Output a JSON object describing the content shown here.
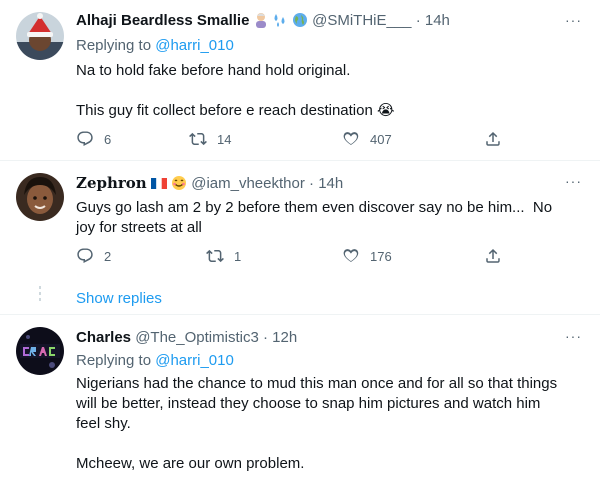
{
  "tweets": [
    {
      "name": "Alhaji Beardless Smallie",
      "name_emojis": [
        "old-man-emoji",
        "sweat-droplets-emoji",
        "globe-emoji"
      ],
      "handle": "@SMiTHiE___",
      "time": "14h",
      "replying_prefix": "Replying to ",
      "replying_to": "@harri_010",
      "text": "Na to hold fake before hand hold original.\n\nThis guy fit collect before e reach destination 😭",
      "replies": "6",
      "retweets": "14",
      "likes": "407"
    },
    {
      "name": "𝐙𝐞𝐩𝐡𝐫𝐨𝐧",
      "name_emojis": [
        "france-flag-emoji",
        "smiling-face-emoji"
      ],
      "handle": "@iam_vheekthor",
      "time": "14h",
      "text": "Guys go lash am 2 by 2 before them even discover say no be him...  No joy for streets at all",
      "replies": "2",
      "retweets": "1",
      "likes": "176"
    },
    {
      "name": "Charles",
      "handle": "@The_Optimistic3",
      "time": "12h",
      "replying_prefix": "Replying to ",
      "replying_to": "@harri_010",
      "text": "Nigerians had the chance to mud this man once and for all so that things will be better, instead they choose to snap him pictures and watch him feel shy.\n\nMcheew, we are our own problem."
    }
  ],
  "show_replies": "Show replies",
  "separator": " · ",
  "more_glyph": "···",
  "colors": {
    "accent": "#1d9bf0",
    "secondary_text": "#536471",
    "divider": "#eff3f4"
  }
}
